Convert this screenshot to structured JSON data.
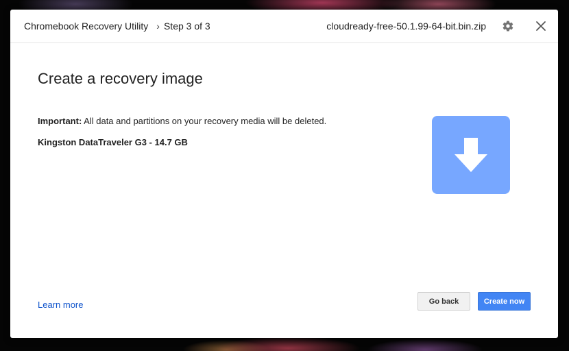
{
  "header": {
    "app_title": "Chromebook Recovery Utility",
    "step_separator": "›",
    "step_label": "Step 3 of 3",
    "filename": "cloudready-free-50.1.99-64-bit.bin.zip",
    "settings_icon": "gear-icon",
    "close_icon": "close-icon"
  },
  "main": {
    "title": "Create a recovery image",
    "warning_label": "Important:",
    "warning_text": " All data and partitions on your recovery media will be deleted.",
    "device_name": "Kingston DataTraveler G3 - 14.7 GB",
    "illustration_icon": "download-arrow-icon"
  },
  "footer": {
    "learn_more": "Learn more",
    "back_label": "Go back",
    "create_label": "Create now"
  },
  "colors": {
    "accent": "#4285f4",
    "tile": "#77a7ff",
    "link": "#1155cc"
  }
}
